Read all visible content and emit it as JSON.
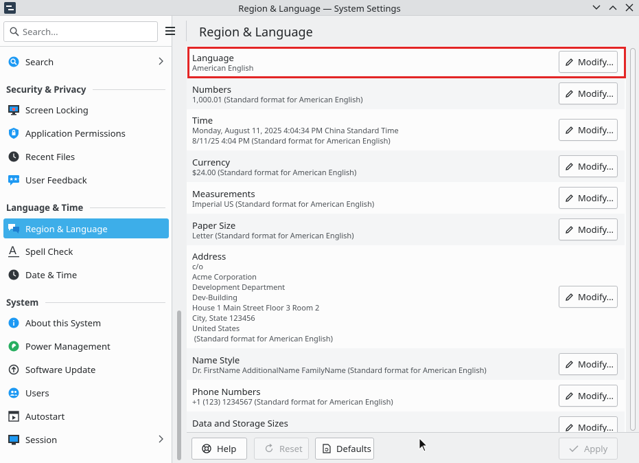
{
  "window": {
    "title": "Region & Language — System Settings"
  },
  "sidebar": {
    "search_placeholder": "Search...",
    "items": [
      {
        "label": "Search",
        "icon": "search-icon"
      },
      {
        "label": "Screen Locking",
        "icon": "screen-lock-icon"
      },
      {
        "label": "Application Permissions",
        "icon": "shield-icon"
      },
      {
        "label": "Recent Files",
        "icon": "clock-icon"
      },
      {
        "label": "User Feedback",
        "icon": "feedback-icon"
      },
      {
        "label": "Region & Language",
        "icon": "region-language-icon",
        "selected": true
      },
      {
        "label": "Spell Check",
        "icon": "spell-check-icon"
      },
      {
        "label": "Date & Time",
        "icon": "clock-icon"
      },
      {
        "label": "About this System",
        "icon": "info-icon"
      },
      {
        "label": "Power Management",
        "icon": "power-icon"
      },
      {
        "label": "Software Update",
        "icon": "update-icon"
      },
      {
        "label": "Users",
        "icon": "users-icon"
      },
      {
        "label": "Autostart",
        "icon": "autostart-icon"
      },
      {
        "label": "Session",
        "icon": "session-icon"
      }
    ],
    "sections": [
      "Security & Privacy",
      "Language & Time",
      "System"
    ]
  },
  "main": {
    "title": "Region & Language",
    "modify_label": "Modify...",
    "rows": [
      {
        "title": "Language",
        "value": "American English"
      },
      {
        "title": "Numbers",
        "value": "1,000.01 (Standard format for American English)"
      },
      {
        "title": "Time",
        "value": "Monday, August 11, 2025 4:04:34 PM China Standard Time\n8/11/25 4:04 PM (Standard format for American English)"
      },
      {
        "title": "Currency",
        "value": "$24.00 (Standard format for American English)"
      },
      {
        "title": "Measurements",
        "value": "Imperial US (Standard format for American English)"
      },
      {
        "title": "Paper Size",
        "value": "Letter (Standard format for American English)"
      },
      {
        "title": "Address",
        "value": "c/o\nAcme Corporation\nDevelopment Department\nDev-Building\nHouse 1 Main Street Floor 3 Room 2\nCity, State 123456\nUnited States\n (Standard format for American English)"
      },
      {
        "title": "Name Style",
        "value": "Dr. FirstName AdditionalName FamilyName (Standard format for American English)"
      },
      {
        "title": "Phone Numbers",
        "value": "+1 (123) 1234567 (Standard format for American English)"
      },
      {
        "title": "Data and Storage Sizes",
        "value": ""
      }
    ]
  },
  "footer": {
    "help": "Help",
    "reset": "Reset",
    "defaults": "Defaults",
    "apply": "Apply"
  },
  "colors": {
    "accent": "#3daee9",
    "highlight": "#e32626"
  }
}
